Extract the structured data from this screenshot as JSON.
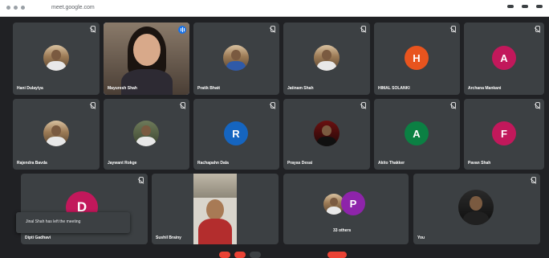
{
  "browser": {
    "url": "meet.google.com"
  },
  "participants_row1": [
    {
      "name": "Hani Dulayiya",
      "avatar": "photo",
      "mic_muted": true
    },
    {
      "name": "Mayuresh Shah",
      "avatar": "video",
      "speaking": true
    },
    {
      "name": "Pratik Bhatt",
      "avatar": "photo",
      "mic_muted": true
    },
    {
      "name": "Jatinam Shah",
      "avatar": "photo",
      "mic_muted": true
    },
    {
      "name": "HIMAL SOLANKI",
      "avatar_letter": "H",
      "avatar_color": "#e8541e",
      "mic_muted": true
    },
    {
      "name": "Archana Mankani",
      "avatar_letter": "A",
      "avatar_color": "#c2185b",
      "mic_muted": true
    }
  ],
  "participants_row2": [
    {
      "name": "Rajendra Bavda",
      "avatar": "photo",
      "mic_muted": true
    },
    {
      "name": "Jaywant Rokge",
      "avatar": "photo",
      "mic_muted": true
    },
    {
      "name": "Rachapahn Dala",
      "avatar_letter": "R",
      "avatar_color": "#1565c0",
      "mic_muted": true
    },
    {
      "name": "Prayas Desai",
      "avatar": "photo",
      "mic_muted": true
    },
    {
      "name": "Akito Thakker",
      "avatar_letter": "A",
      "avatar_color": "#0b8043",
      "mic_muted": true
    },
    {
      "name": "Pavan Shah",
      "avatar_letter": "F",
      "avatar_color": "#c2185b",
      "mic_muted": true
    }
  ],
  "participants_row3": [
    {
      "name": "Dipti Gadhavi",
      "avatar_letter": "D",
      "avatar_color": "#c2185b",
      "mic_muted": true
    },
    {
      "name": "Sushil Brainy",
      "avatar": "video"
    },
    {
      "name": "33 others",
      "avatar_letter": "P",
      "avatar_color": "#8e24aa"
    },
    {
      "name": "You",
      "avatar": "photo",
      "mic_muted": true
    }
  ],
  "toast": {
    "message": "Jinal Shah has left the meeting"
  }
}
